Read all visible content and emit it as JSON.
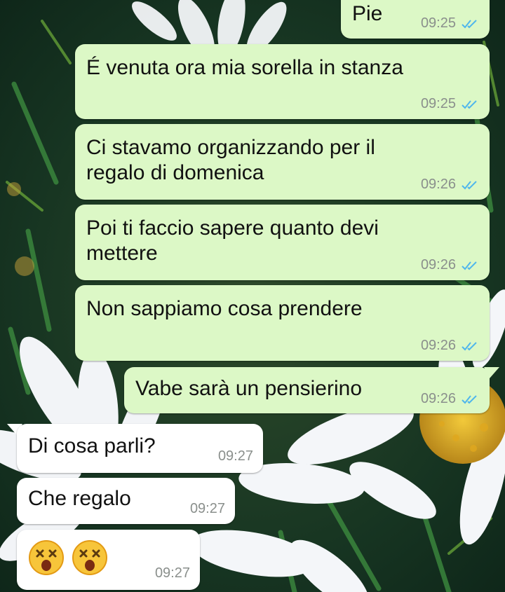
{
  "messages": [
    {
      "dir": "out",
      "text": "Pie",
      "time": "09:25",
      "status": "read"
    },
    {
      "dir": "out",
      "text": "É venuta ora mia sorella in stanza",
      "time": "09:25",
      "status": "read"
    },
    {
      "dir": "out",
      "text": "Ci stavamo organizzando per il regalo di domenica",
      "time": "09:26",
      "status": "read"
    },
    {
      "dir": "out",
      "text": "Poi ti faccio sapere quanto devi mettere",
      "time": "09:26",
      "status": "read"
    },
    {
      "dir": "out",
      "text": "Non sappiamo cosa prendere",
      "time": "09:26",
      "status": "read"
    },
    {
      "dir": "out",
      "text": "Vabe sarà un pensierino",
      "time": "09:26",
      "status": "read"
    },
    {
      "dir": "in",
      "text": "Di cosa parli?",
      "time": "09:27"
    },
    {
      "dir": "in",
      "text": "Che regalo",
      "time": "09:27"
    },
    {
      "dir": "in",
      "emoji": [
        "dizzy-face-icon",
        "dizzy-face-icon"
      ],
      "time": "09:27"
    }
  ],
  "colors": {
    "outgoing_bubble": "#dcf8c6",
    "incoming_bubble": "#ffffff",
    "read_ticks": "#4fb6ec",
    "timestamp": "#8a8f8c",
    "wallpaper_dark": "#0f2a1c"
  }
}
